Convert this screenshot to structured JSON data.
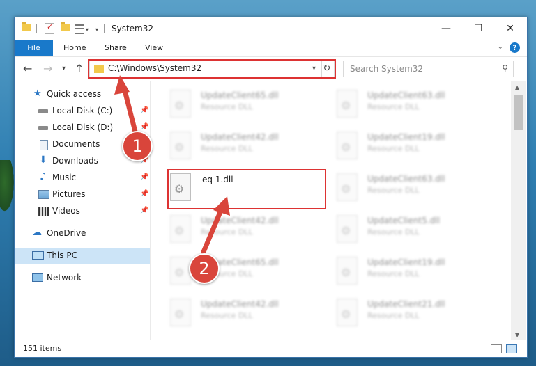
{
  "window": {
    "title": "System32",
    "controls": {
      "minimize": "—",
      "maximize": "☐",
      "close": "✕"
    }
  },
  "ribbon": {
    "tabs": [
      "File",
      "Home",
      "Share",
      "View"
    ],
    "help": "?"
  },
  "navigation": {
    "address": "C:\\Windows\\System32",
    "search_placeholder": "Search System32"
  },
  "sidebar": {
    "items": [
      {
        "label": "Quick access",
        "icon": "star-icon",
        "pinned": false
      },
      {
        "label": "Local Disk (C:)",
        "icon": "drive-icon",
        "pinned": true
      },
      {
        "label": "Local Disk (D:)",
        "icon": "drive-icon",
        "pinned": true
      },
      {
        "label": "Documents",
        "icon": "documents-icon",
        "pinned": true
      },
      {
        "label": "Downloads",
        "icon": "download-icon",
        "pinned": true
      },
      {
        "label": "Music",
        "icon": "music-icon",
        "pinned": true
      },
      {
        "label": "Pictures",
        "icon": "pictures-icon",
        "pinned": true
      },
      {
        "label": "Videos",
        "icon": "videos-icon",
        "pinned": true
      },
      {
        "label": "OneDrive",
        "icon": "cloud-icon",
        "pinned": false
      },
      {
        "label": "This PC",
        "icon": "computer-icon",
        "pinned": false,
        "selected": true
      },
      {
        "label": "Network",
        "icon": "network-icon",
        "pinned": false
      }
    ]
  },
  "files": {
    "left_column": [
      {
        "name": "UpdateClient65.dll",
        "type": "Resource DLL"
      },
      {
        "name": "UpdateClient42.dll",
        "type": "Resource DLL"
      },
      {
        "name": "eq 1.dll",
        "type": ""
      },
      {
        "name": "UpdateClient42.dll",
        "type": "Resource DLL"
      },
      {
        "name": "UpdateClient65.dll",
        "type": "Resource DLL"
      },
      {
        "name": "UpdateClient42.dll",
        "type": "Resource DLL"
      }
    ],
    "right_column": [
      {
        "name": "UpdateClient63.dll",
        "type": "Resource DLL"
      },
      {
        "name": "UpdateClient19.dll",
        "type": "Resource DLL"
      },
      {
        "name": "UpdateClient63.dll",
        "type": "Resource DLL"
      },
      {
        "name": "UpdateClient5.dll",
        "type": "Resource DLL"
      },
      {
        "name": "UpdateClient19.dll",
        "type": "Resource DLL"
      },
      {
        "name": "UpdateClient21.dll",
        "type": "Resource DLL"
      }
    ]
  },
  "status": {
    "item_count": "151 items"
  },
  "annotations": {
    "step1": "1",
    "step2": "2"
  },
  "colors": {
    "accent": "#1979ca",
    "highlight_box": "#dd3333",
    "badge": "#d9453b"
  }
}
